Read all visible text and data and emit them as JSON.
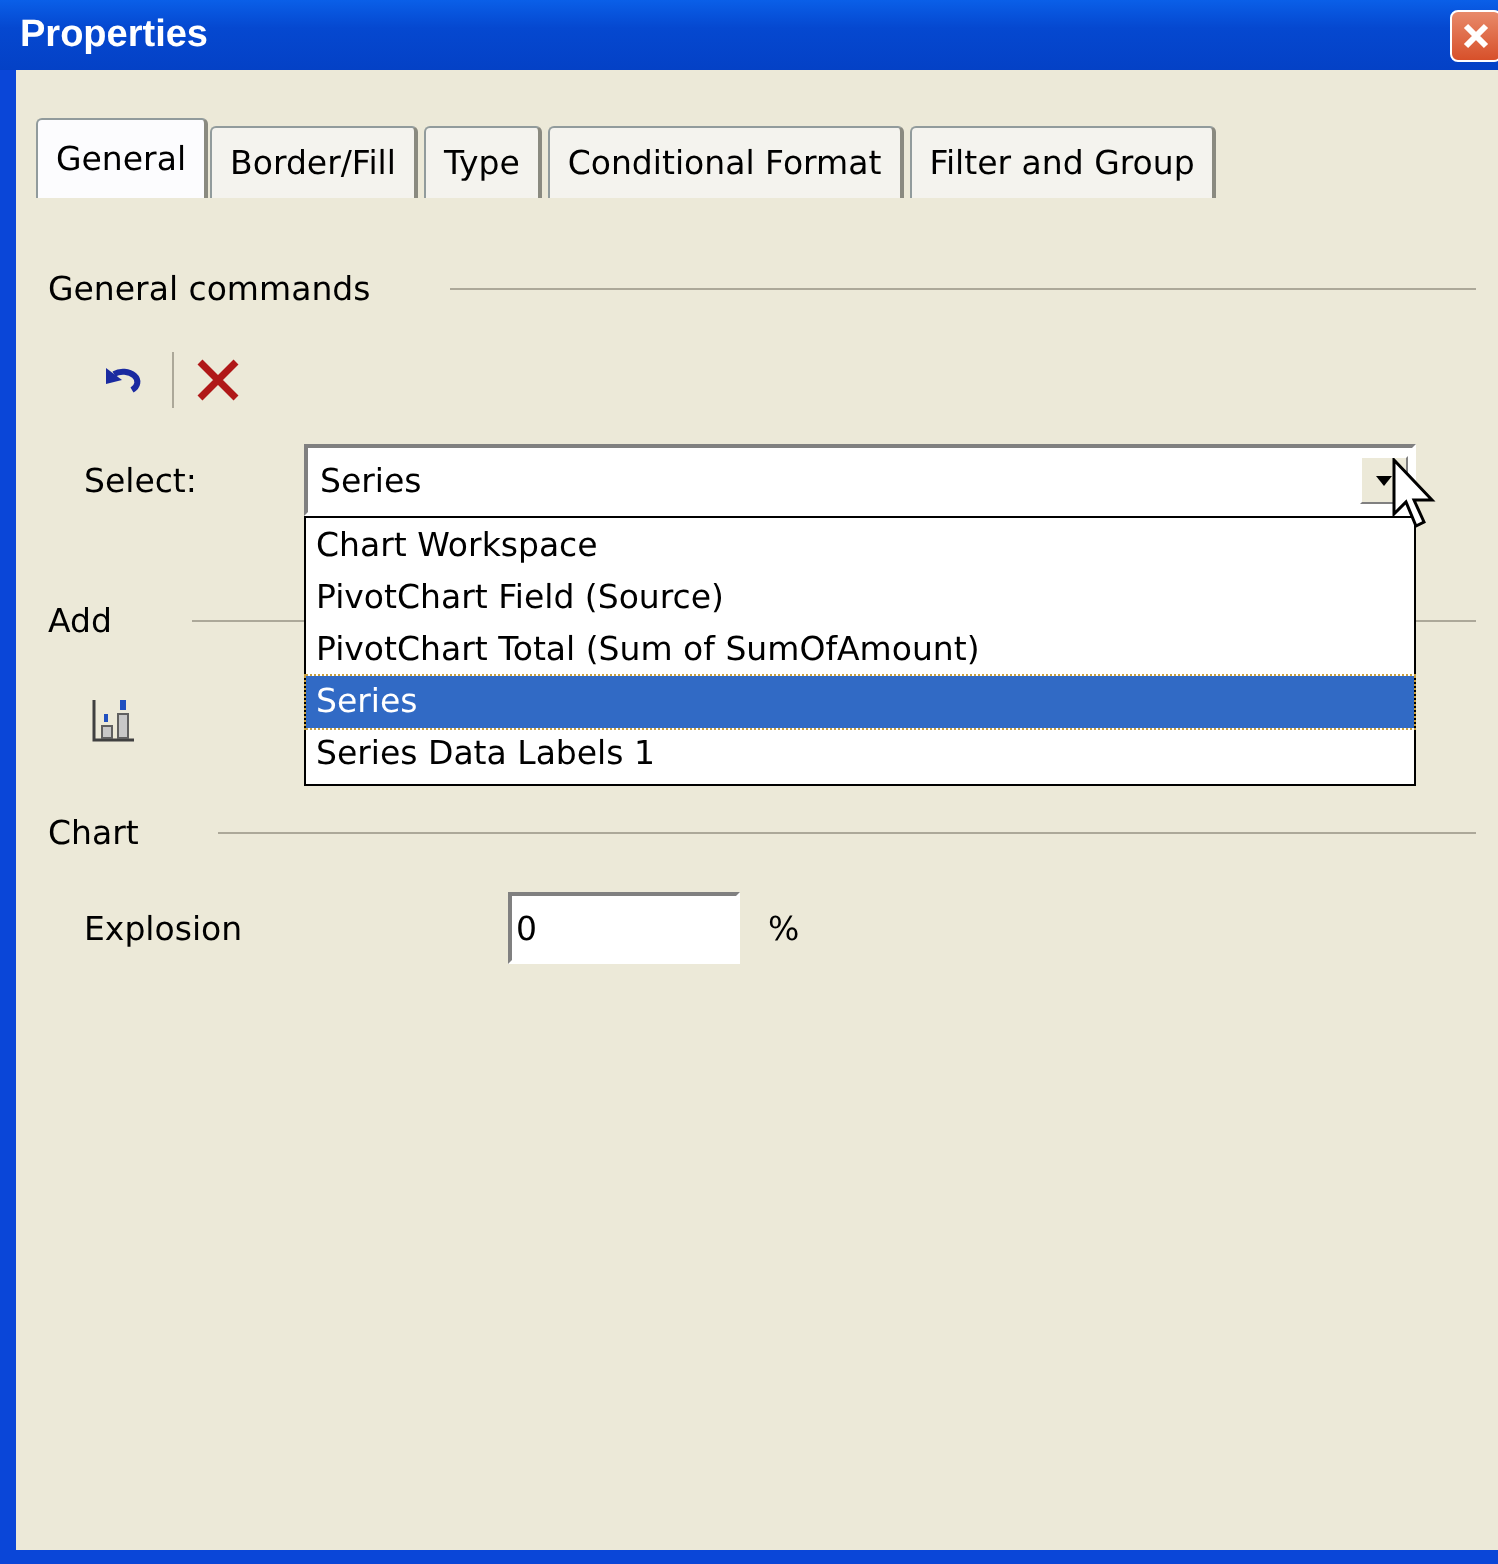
{
  "window": {
    "title": "Properties"
  },
  "tabs": [
    {
      "label": "General",
      "selected": true
    },
    {
      "label": "Border/Fill",
      "selected": false
    },
    {
      "label": "Type",
      "selected": false
    },
    {
      "label": "Conditional Format",
      "selected": false
    },
    {
      "label": "Filter and Group",
      "selected": false
    }
  ],
  "general_commands": {
    "title": "General commands"
  },
  "select": {
    "label": "Select:",
    "value": "Series",
    "expanded": true,
    "options": [
      {
        "label": "Chart Workspace",
        "selected": false
      },
      {
        "label": "PivotChart Field (Source)",
        "selected": false
      },
      {
        "label": "PivotChart Total (Sum of SumOfAmount)",
        "selected": false
      },
      {
        "label": "Series",
        "selected": true
      },
      {
        "label": "Series Data Labels 1",
        "selected": false
      }
    ]
  },
  "add": {
    "title": "Add"
  },
  "chart": {
    "title": "Chart",
    "fields": [
      {
        "label": "Explosion",
        "value": "0",
        "unit": "%"
      }
    ]
  }
}
